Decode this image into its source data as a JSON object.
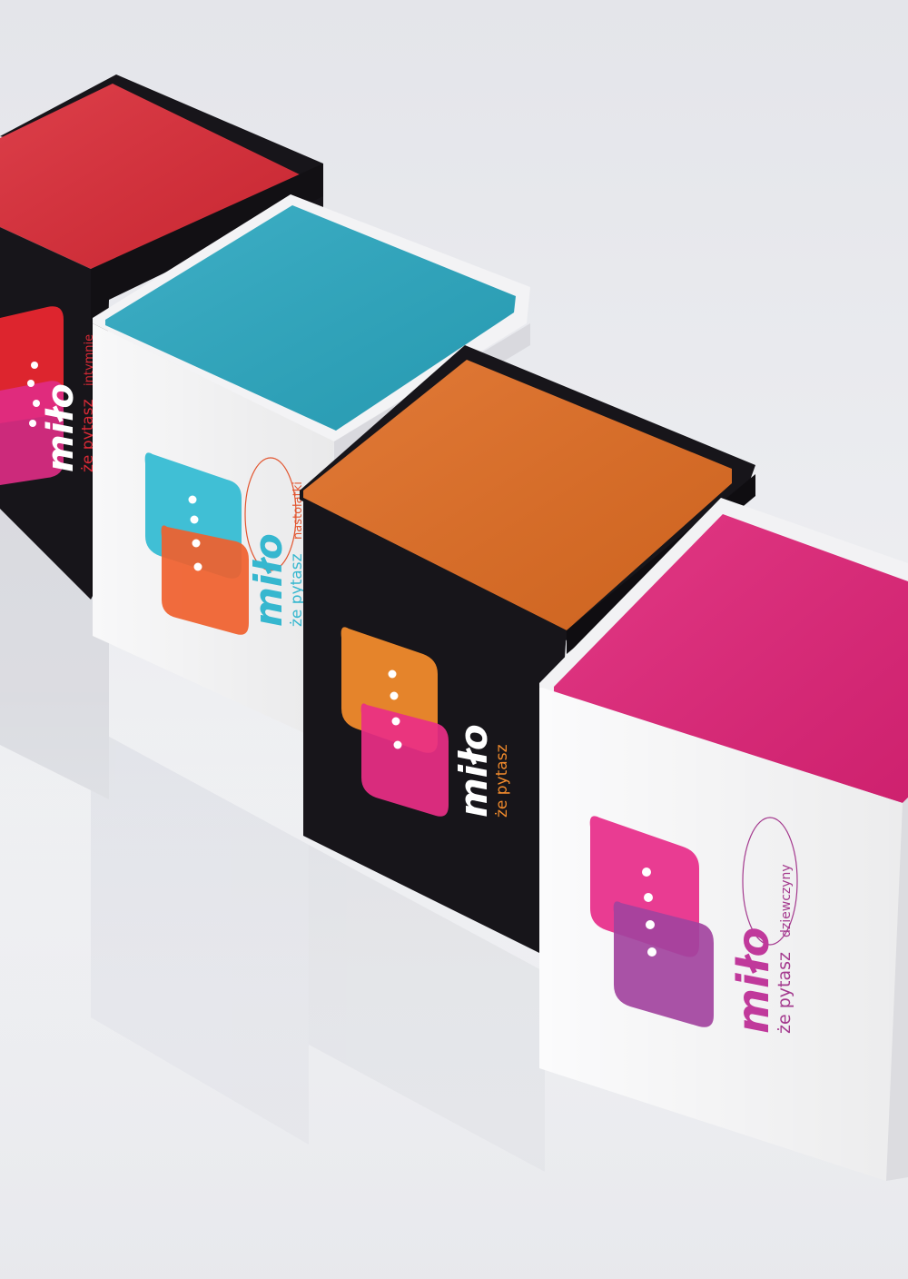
{
  "photo": {
    "background_color": "#e9eaee",
    "boxes": [
      {
        "id": "red",
        "body_color": "#17151a",
        "lid_color": "#d92a36",
        "brand_text": "miło",
        "tagline": "że pytasz",
        "edition": "intymnie",
        "brand_color": "#ffffff",
        "edition_color": "#d92a36",
        "logo_top_color": "#e8262f",
        "logo_bottom_color": "#e02c86"
      },
      {
        "id": "teal",
        "body_color": "#f8f8f9",
        "lid_color": "#2aa7c0",
        "brand_text": "miło",
        "tagline": "że pytasz",
        "edition": "nastolatki",
        "brand_color": "#36b7cf",
        "edition_color": "#e2552f",
        "logo_top_color": "#36bcd3",
        "logo_bottom_color": "#f0602d"
      },
      {
        "id": "orange",
        "body_color": "#17151a",
        "lid_color": "#df6c22",
        "brand_text": "miło",
        "tagline": "że pytasz",
        "edition": "",
        "brand_color": "#ffffff",
        "edition_color": "#f08a2c",
        "logo_top_color": "#f08a2c",
        "logo_bottom_color": "#ea2f86"
      },
      {
        "id": "pink",
        "body_color": "#fbfbfc",
        "lid_color": "#e02478",
        "brand_text": "miło",
        "tagline": "że pytasz",
        "edition": "dziewczyny",
        "brand_color": "#c0399b",
        "edition_color": "#a43a8e",
        "logo_top_color": "#e8328c",
        "logo_bottom_color": "#a2439e"
      }
    ]
  }
}
